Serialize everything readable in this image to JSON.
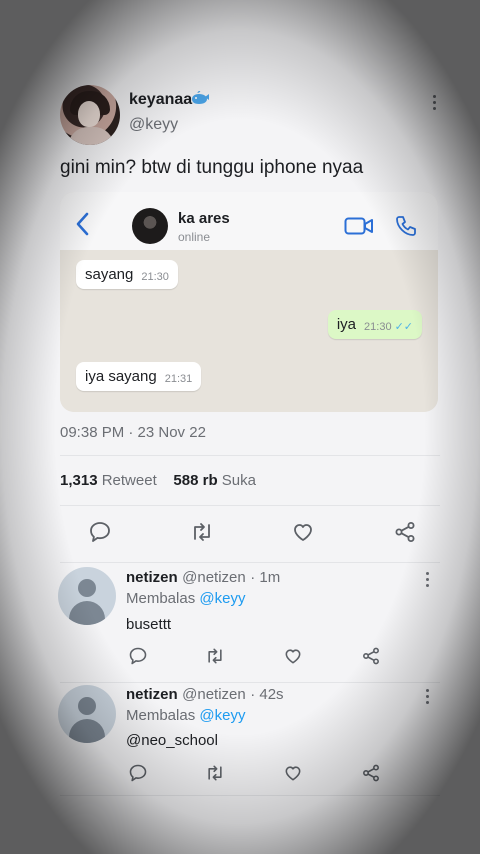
{
  "tweet": {
    "display_name": "keyanaa",
    "badge_icon": "whale-icon",
    "handle": "@keyy",
    "text": "gini min? btw di tunggu iphone nyaa",
    "timestamp": "09:38 PM · 23 Nov 22",
    "retweet_count": "1,313",
    "retweet_label": "Retweet",
    "like_count": "588 rb",
    "like_label": "Suka"
  },
  "chat": {
    "contact_name": "ka ares",
    "status": "online",
    "messages": [
      {
        "text": "sayang",
        "time": "21:30",
        "direction": "in"
      },
      {
        "text": "iya",
        "time": "21:30",
        "direction": "out",
        "read": true
      },
      {
        "text": "iya sayang",
        "time": "21:31",
        "direction": "in"
      }
    ]
  },
  "replies": [
    {
      "name": "netizen",
      "handle": "@netizen",
      "age": "· 1m",
      "replying_label": "Membalas",
      "replying_to": "@keyy",
      "text": "busettt",
      "text_is_link": false
    },
    {
      "name": "netizen",
      "handle": "@netizen",
      "age": "· 42s",
      "replying_label": "Membalas",
      "replying_to": "@keyy",
      "text": "@neo_school",
      "text_is_link": true
    }
  ],
  "colors": {
    "accent": "#1d9bf0",
    "chat_accent": "#2b6fd6",
    "out_bubble": "#dcf8c6"
  }
}
